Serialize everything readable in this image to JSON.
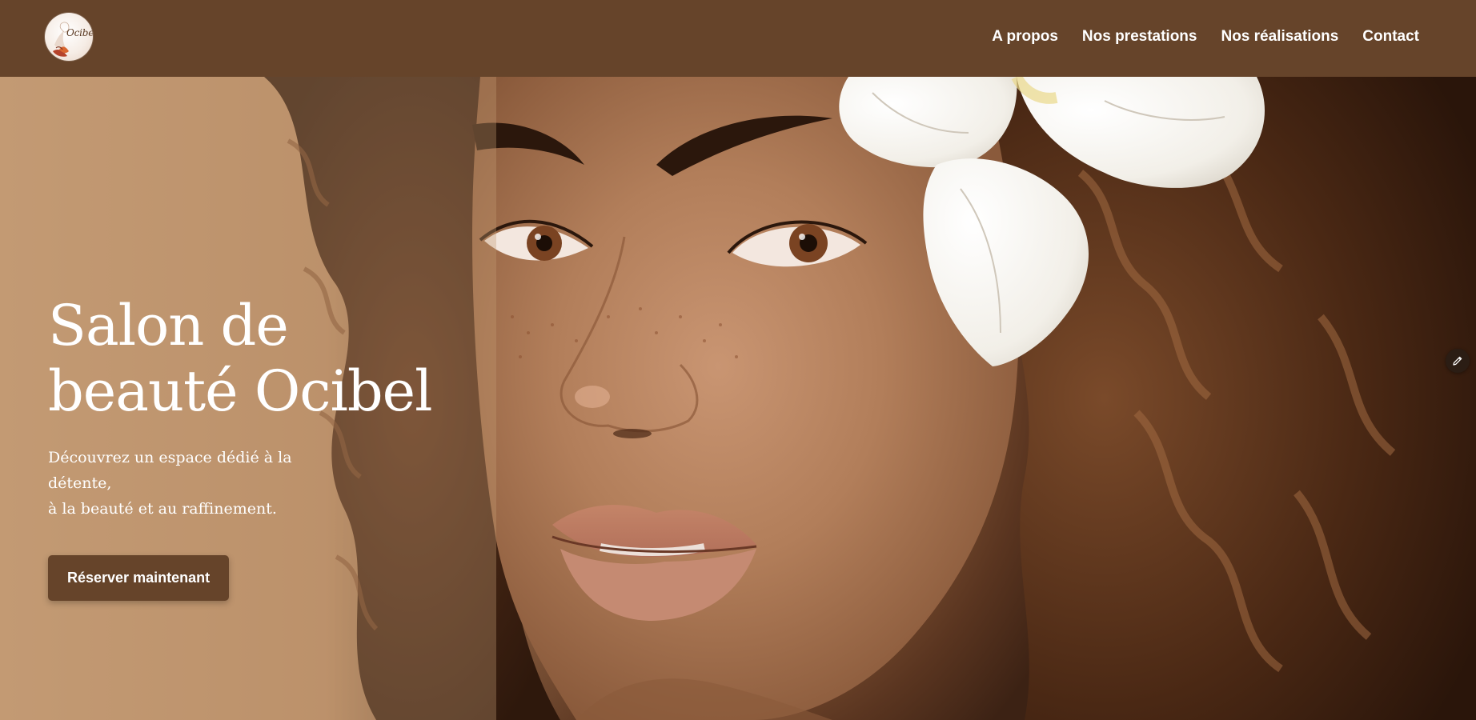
{
  "header": {
    "logo_text": "Ocibel",
    "nav": [
      {
        "label": "A propos"
      },
      {
        "label": "Nos prestations"
      },
      {
        "label": "Nos réalisations"
      },
      {
        "label": "Contact"
      }
    ]
  },
  "hero": {
    "title_line1": "Salon de",
    "title_line2": "beauté Ocibel",
    "subtitle_line1": "Découvrez un espace dédié à la détente,",
    "subtitle_line2": "à la beauté et au raffinement.",
    "cta_label": "Réserver maintenant",
    "image_subject": "portrait-woman-curly-hair-white-flower"
  },
  "floating": {
    "edit_icon": "pencil-icon"
  },
  "colors": {
    "header_bg": "#66442a",
    "button_bg": "#66442a",
    "text_light": "#ffffff",
    "hero_left_bg": "#c39a74"
  }
}
